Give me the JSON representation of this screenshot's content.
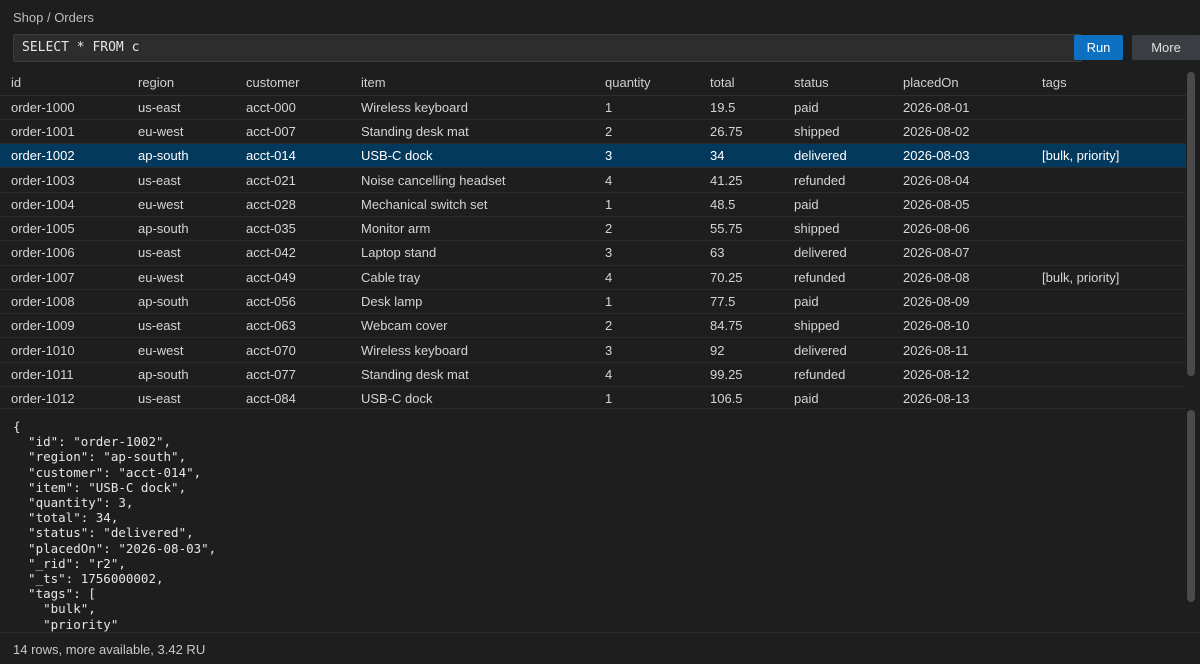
{
  "breadcrumb": "Shop / Orders",
  "query": {
    "value": "SELECT * FROM c",
    "run_label": "Run",
    "more_label": "More"
  },
  "columns": [
    "id",
    "region",
    "customer",
    "item",
    "quantity",
    "total",
    "status",
    "placedOn",
    "tags"
  ],
  "rows": [
    [
      "order-1000",
      "us-east",
      "acct-000",
      "Wireless keyboard",
      "1",
      "19.5",
      "paid",
      "2026-08-01",
      ""
    ],
    [
      "order-1001",
      "eu-west",
      "acct-007",
      "Standing desk mat",
      "2",
      "26.75",
      "shipped",
      "2026-08-02",
      ""
    ],
    [
      "order-1002",
      "ap-south",
      "acct-014",
      "USB-C dock",
      "3",
      "34",
      "delivered",
      "2026-08-03",
      "[bulk, priority]"
    ],
    [
      "order-1003",
      "us-east",
      "acct-021",
      "Noise cancelling headset",
      "4",
      "41.25",
      "refunded",
      "2026-08-04",
      ""
    ],
    [
      "order-1004",
      "eu-west",
      "acct-028",
      "Mechanical switch set",
      "1",
      "48.5",
      "paid",
      "2026-08-05",
      ""
    ],
    [
      "order-1005",
      "ap-south",
      "acct-035",
      "Monitor arm",
      "2",
      "55.75",
      "shipped",
      "2026-08-06",
      ""
    ],
    [
      "order-1006",
      "us-east",
      "acct-042",
      "Laptop stand",
      "3",
      "63",
      "delivered",
      "2026-08-07",
      ""
    ],
    [
      "order-1007",
      "eu-west",
      "acct-049",
      "Cable tray",
      "4",
      "70.25",
      "refunded",
      "2026-08-08",
      "[bulk, priority]"
    ],
    [
      "order-1008",
      "ap-south",
      "acct-056",
      "Desk lamp",
      "1",
      "77.5",
      "paid",
      "2026-08-09",
      ""
    ],
    [
      "order-1009",
      "us-east",
      "acct-063",
      "Webcam cover",
      "2",
      "84.75",
      "shipped",
      "2026-08-10",
      ""
    ],
    [
      "order-1010",
      "eu-west",
      "acct-070",
      "Wireless keyboard",
      "3",
      "92",
      "delivered",
      "2026-08-11",
      ""
    ],
    [
      "order-1011",
      "ap-south",
      "acct-077",
      "Standing desk mat",
      "4",
      "99.25",
      "refunded",
      "2026-08-12",
      ""
    ],
    [
      "order-1012",
      "us-east",
      "acct-084",
      "USB-C dock",
      "1",
      "106.5",
      "paid",
      "2026-08-13",
      ""
    ]
  ],
  "selected_row": 2,
  "detail_json": "{\n  \"id\": \"order-1002\",\n  \"region\": \"ap-south\",\n  \"customer\": \"acct-014\",\n  \"item\": \"USB-C dock\",\n  \"quantity\": 3,\n  \"total\": 34,\n  \"status\": \"delivered\",\n  \"placedOn\": \"2026-08-03\",\n  \"_rid\": \"r2\",\n  \"_ts\": 1756000002,\n  \"tags\": [\n    \"bulk\",\n    \"priority\"\n  ]\n}",
  "status": "14 rows, more available, 3.42 RU",
  "colors": {
    "background": "#1e1e1e",
    "accent": "#0e70c0",
    "selection": "#04395e"
  }
}
